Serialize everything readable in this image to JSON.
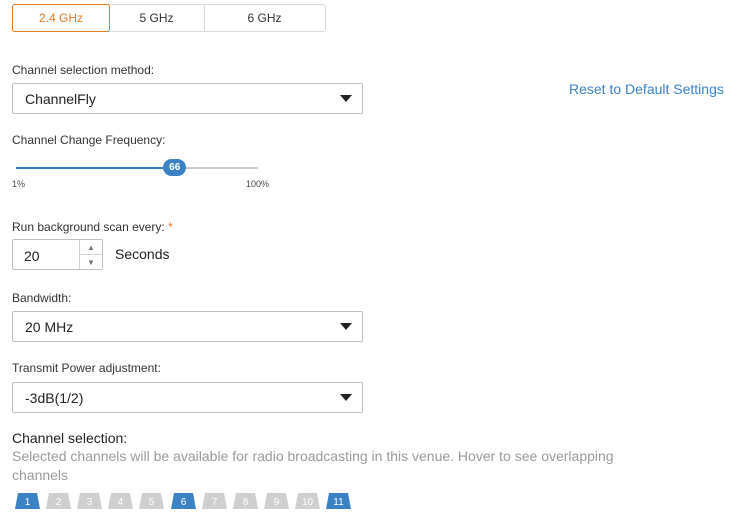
{
  "band_tabs": [
    {
      "label": "2.4 GHz",
      "active": true
    },
    {
      "label": "5 GHz",
      "active": false
    },
    {
      "label": "6 GHz",
      "active": false
    }
  ],
  "channel_method": {
    "label": "Channel selection method:",
    "value": "ChannelFly"
  },
  "reset_link": "Reset to Default Settings",
  "frequency": {
    "label": "Channel Change Frequency:",
    "value": "66",
    "min_label": "1%",
    "max_label": "100%",
    "level_percent": 66
  },
  "scan": {
    "label": "Run background scan every:",
    "required_mark": "*",
    "value": "20",
    "unit": "Seconds"
  },
  "bandwidth": {
    "label": "Bandwidth:",
    "value": "20 MHz"
  },
  "power": {
    "label": "Transmit Power adjustment:",
    "value": "-3dB(1/2)"
  },
  "channel_selection": {
    "heading": "Channel selection:",
    "description": "Selected channels will be available for radio broadcasting in this venue. Hover to see overlapping channels",
    "channels": [
      {
        "label": "1",
        "selected": true
      },
      {
        "label": "2",
        "selected": false
      },
      {
        "label": "3",
        "selected": false
      },
      {
        "label": "4",
        "selected": false
      },
      {
        "label": "5",
        "selected": false
      },
      {
        "label": "6",
        "selected": true
      },
      {
        "label": "7",
        "selected": false
      },
      {
        "label": "8",
        "selected": false
      },
      {
        "label": "9",
        "selected": false
      },
      {
        "label": "10",
        "selected": false
      },
      {
        "label": "11",
        "selected": true
      }
    ]
  },
  "colors": {
    "accent": "#e07b25",
    "primary": "#3b82c4",
    "chip_inactive": "#cfcfcf"
  }
}
